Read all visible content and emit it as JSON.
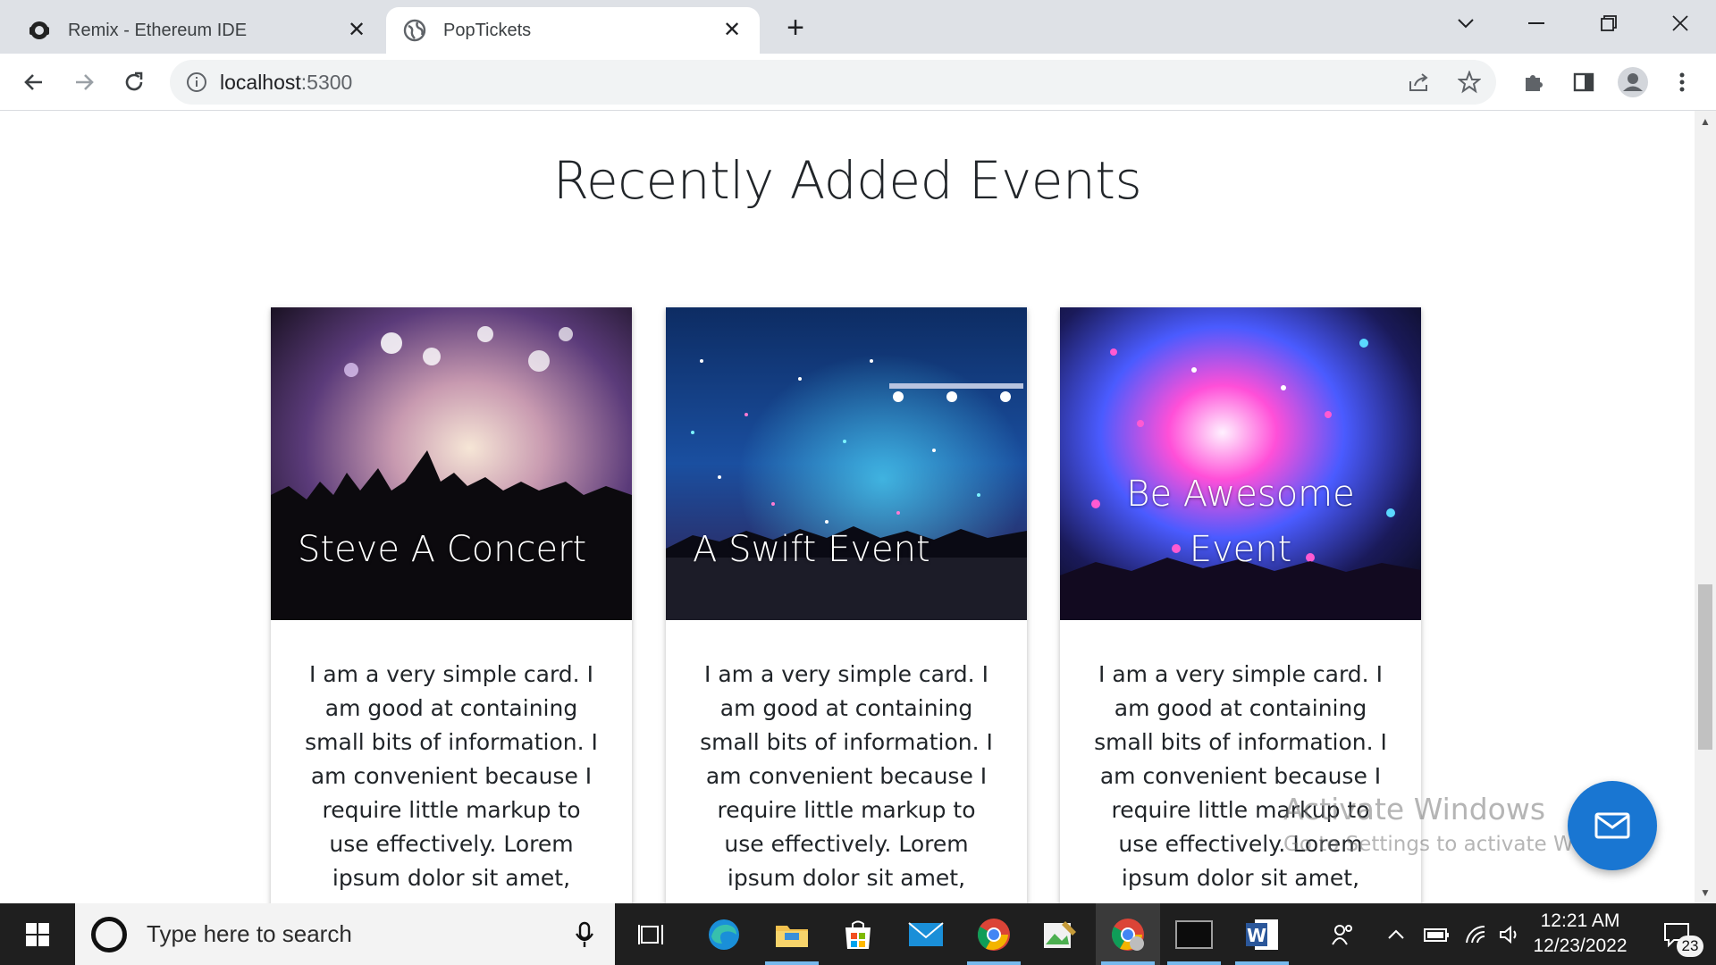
{
  "browser": {
    "tabs": [
      {
        "title": "Remix - Ethereum IDE",
        "active": false,
        "icon": "remix-icon"
      },
      {
        "title": "PopTickets",
        "active": true,
        "icon": "globe-icon"
      }
    ],
    "url_host": "localhost",
    "url_port": ":5300"
  },
  "page": {
    "heading": "Recently Added Events",
    "cards": [
      {
        "title": "Steve A Concert",
        "body": "I am a very simple card. I am good at containing small bits of information. I am convenient because I require little markup to use effectively. Lorem ipsum dolor sit amet, consectetur"
      },
      {
        "title": "A Swift Event",
        "body": "I am a very simple card. I am good at containing small bits of information. I am convenient because I require little markup to use effectively. Lorem ipsum dolor sit amet, consectetur"
      },
      {
        "title": "Be Awesome Event",
        "body": "I am a very simple card. I am good at containing small bits of information. I am convenient because I require little markup to use effectively. Lorem ipsum dolor sit amet, consectetur"
      }
    ]
  },
  "watermark": {
    "line1": "Activate Windows",
    "line2": "Go to Settings to activate Windows."
  },
  "taskbar": {
    "search_placeholder": "Type here to search",
    "time": "12:21 AM",
    "date": "12/23/2022",
    "notification_count": "23"
  },
  "colors": {
    "fab": "#1976d2",
    "tabstrip": "#dee1e6",
    "taskbar": "#1f1f1f"
  }
}
